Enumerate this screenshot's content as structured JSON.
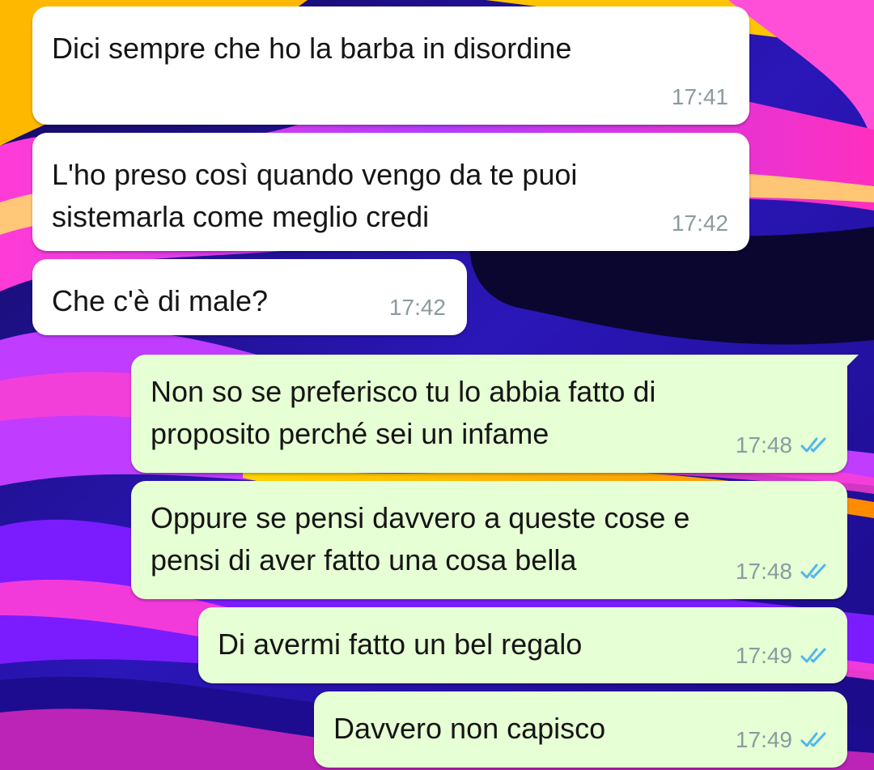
{
  "chat": {
    "messages": [
      {
        "direction": "incoming",
        "text": "Dici sempre che ho la barba in disordine",
        "time": "17:41"
      },
      {
        "direction": "incoming",
        "text": "L'ho preso così quando vengo da te puoi\nsistemarla come meglio credi",
        "time": "17:42"
      },
      {
        "direction": "incoming",
        "text": "Che c'è di male?",
        "time": "17:42"
      },
      {
        "direction": "outgoing",
        "text": "Non so se preferisco tu lo abbia fatto di\nproposito perché sei un infame",
        "time": "17:48",
        "status": "read"
      },
      {
        "direction": "outgoing",
        "text": "Oppure se pensi davvero a queste cose e\npensi di aver fatto una cosa bella",
        "time": "17:48",
        "status": "read"
      },
      {
        "direction": "outgoing",
        "text": "Di avermi fatto un bel regalo",
        "time": "17:49",
        "status": "read"
      },
      {
        "direction": "outgoing",
        "text": "Davvero non capisco",
        "time": "17:49",
        "status": "read"
      }
    ]
  },
  "colors": {
    "incoming_bubble": "#ffffff",
    "outgoing_bubble": "#e6ffd4",
    "read_ticks": "#4fb6ec",
    "timestamp": "#8c9a9f"
  },
  "icons": {
    "read_receipt": "double-check-icon"
  }
}
